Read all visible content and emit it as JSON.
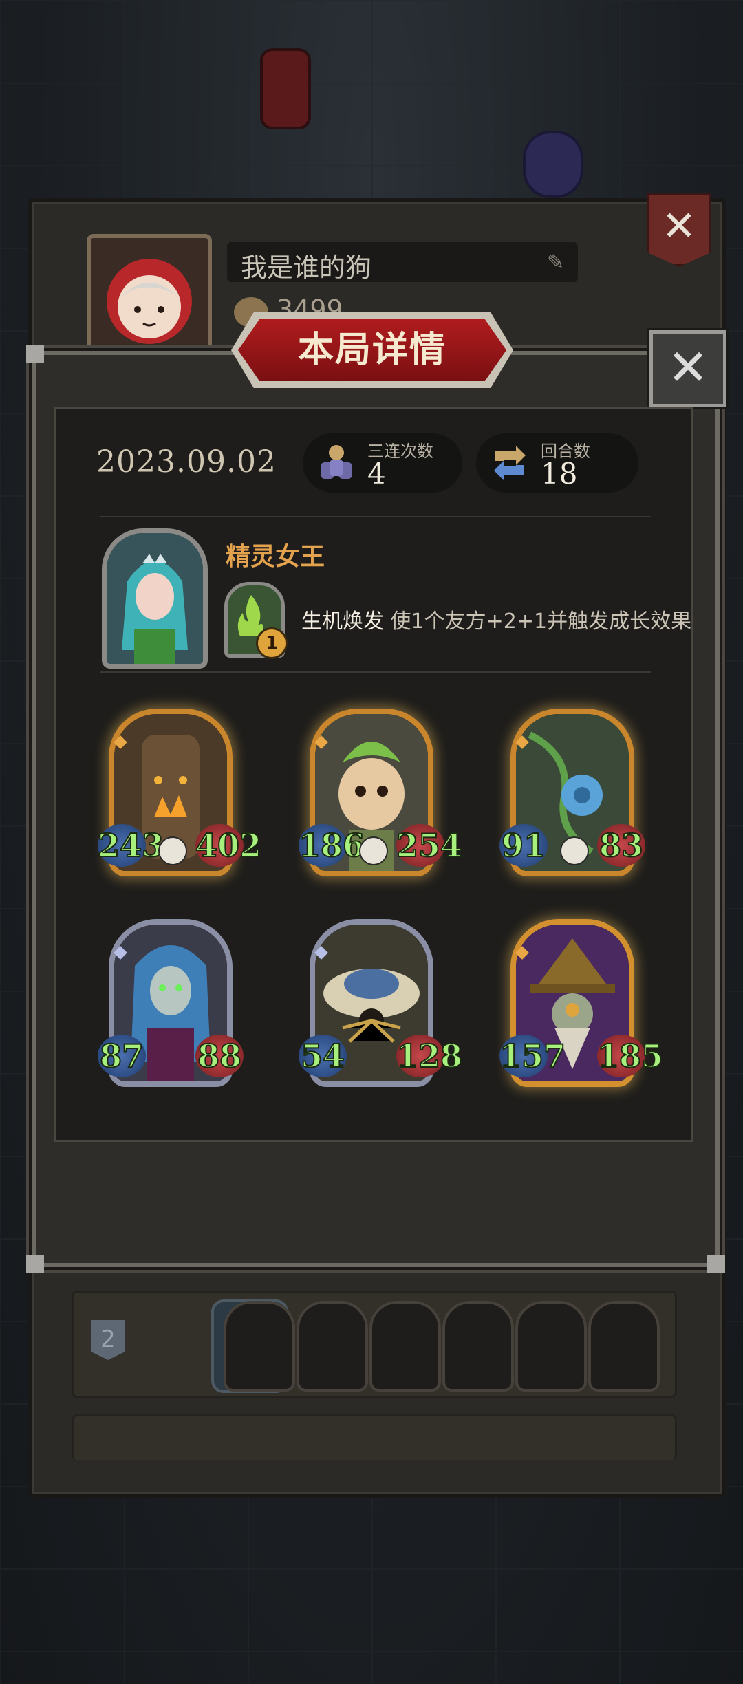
{
  "background": {
    "wall_color": "#1d2024"
  },
  "profile": {
    "player_name": "我是谁的狗",
    "coins": "3499",
    "edit_icon": "pencil-icon",
    "close_icon": "close-icon"
  },
  "modal": {
    "title": "本局详情",
    "close_icon": "close-icon",
    "date": "2023.09.02",
    "stats": [
      {
        "label": "三连次数",
        "value": "4",
        "icon": "triple-stack-icon"
      },
      {
        "label": "回合数",
        "value": "18",
        "icon": "rounds-cycle-icon"
      }
    ],
    "hero": {
      "name": "精灵女王",
      "skill_name": "生机焕发",
      "skill_desc": "使1个友方+2+1并触发成长效果",
      "skill_cost": "1",
      "portrait_icon": "elf-queen-portrait",
      "skill_icon": "green-flame-skill-icon"
    },
    "minions": [
      {
        "attack": "243",
        "health": "402",
        "frame": "gold",
        "art": "treant"
      },
      {
        "attack": "186",
        "health": "254",
        "frame": "gold",
        "art": "leaf-sprout-kid"
      },
      {
        "attack": "91",
        "health": "83",
        "frame": "gold",
        "art": "vine-blue-flower"
      },
      {
        "attack": "87",
        "health": "88",
        "frame": "silver",
        "art": "dark-elf-siren"
      },
      {
        "attack": "54",
        "health": "128",
        "frame": "silver",
        "art": "mushroom-spider"
      },
      {
        "attack": "157",
        "health": "185",
        "frame": "gold",
        "art": "witch-hat-wizard"
      }
    ]
  },
  "history": {
    "rows": [
      {
        "rank": "2"
      }
    ]
  },
  "colors": {
    "accent_gold": "#e3a24d",
    "attack_green": "#a8f07e",
    "title_red": "#b01c1e"
  }
}
